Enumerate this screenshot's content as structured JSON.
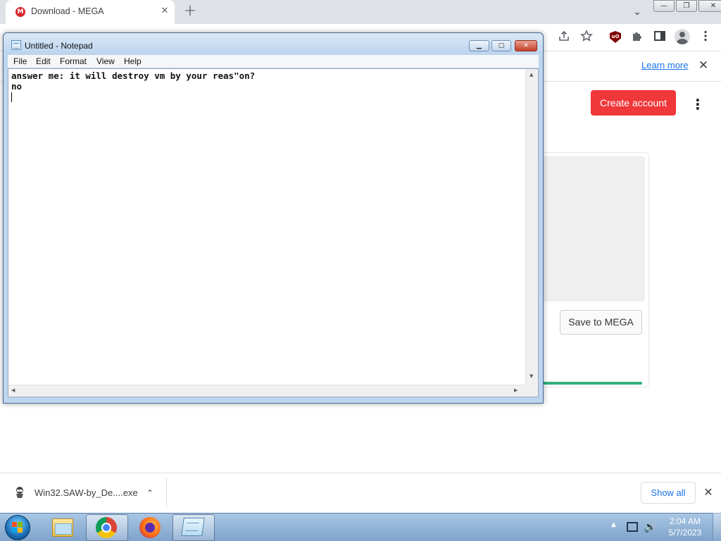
{
  "browser": {
    "tab_title": "Download - MEGA",
    "tab_favicon_letter": "M",
    "tab_close_glyph": "✕",
    "new_tab_glyph": "+",
    "tab_search_glyph": "⌄",
    "window_controls": {
      "minimize": "—",
      "maximize": "❐",
      "close": "✕"
    },
    "toolbar_icons": [
      "share-icon",
      "bookmark-star-icon",
      "ublock-icon",
      "extensions-icon",
      "side-panel-icon",
      "profile-icon",
      "menu-icon"
    ],
    "ublock_label": "uO",
    "infobar": {
      "learn_more": "Learn more",
      "close_glyph": "✕"
    },
    "mega": {
      "create_account": "Create account",
      "kebab_glyph": "⋮",
      "save_button": "Save to MEGA",
      "accent_color": "#f0373a",
      "progress_color": "#31b07a"
    },
    "downloads": {
      "file_name": "Win32.SAW-by_De....exe",
      "chevron_glyph": "⌃",
      "show_all": "Show all",
      "close_glyph": "✕"
    }
  },
  "notepad": {
    "title": "Untitled - Notepad",
    "menu": [
      "File",
      "Edit",
      "Format",
      "View",
      "Help"
    ],
    "content": "answer me: it will destroy vm by your reas\"on?\nno",
    "controls": {
      "minimize": "▁",
      "maximize": "▢",
      "close": "✕"
    }
  },
  "taskbar": {
    "apps": [
      "windows-explorer-icon",
      "chrome-icon",
      "firefox-icon",
      "notepad-icon"
    ],
    "tray_chevron": "▲",
    "volume_glyph": "🔊",
    "clock_time": "2:04 AM",
    "clock_date": "5/7/2023"
  }
}
